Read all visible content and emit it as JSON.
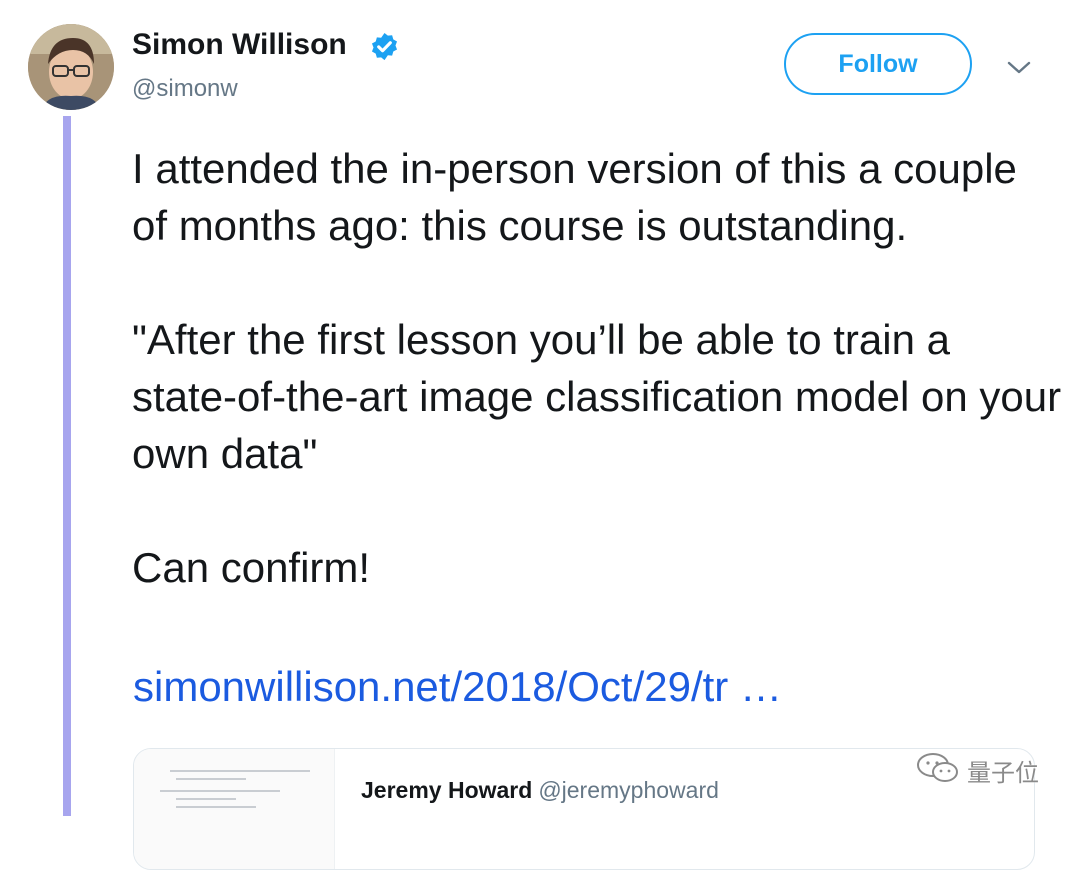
{
  "tweet": {
    "author": {
      "name": "Simon Willison",
      "handle": "@simonw",
      "verified": true,
      "avatar_icon": "avatar-photo"
    },
    "follow_label": "Follow",
    "menu_icon": "chevron-down-icon",
    "paragraphs": [
      "I attended the in-person version of this a couple of months ago: this course is outstanding.",
      "\"After the first lesson you’ll be able to train a state-of-the-art image classification model on your own data\"",
      "Can confirm!"
    ],
    "link_text": "simonwillison.net/2018/Oct/29/tr …"
  },
  "quoted_tweet": {
    "name": "Jeremy Howard",
    "handle": "@jeremyphoward"
  },
  "watermark": {
    "text": "量子位",
    "icon": "wechat-icon"
  },
  "colors": {
    "follow_blue": "#1da1f2",
    "link_blue": "#1b5be0",
    "thread_line": "#a7a5ee",
    "secondary_text": "#657786"
  }
}
